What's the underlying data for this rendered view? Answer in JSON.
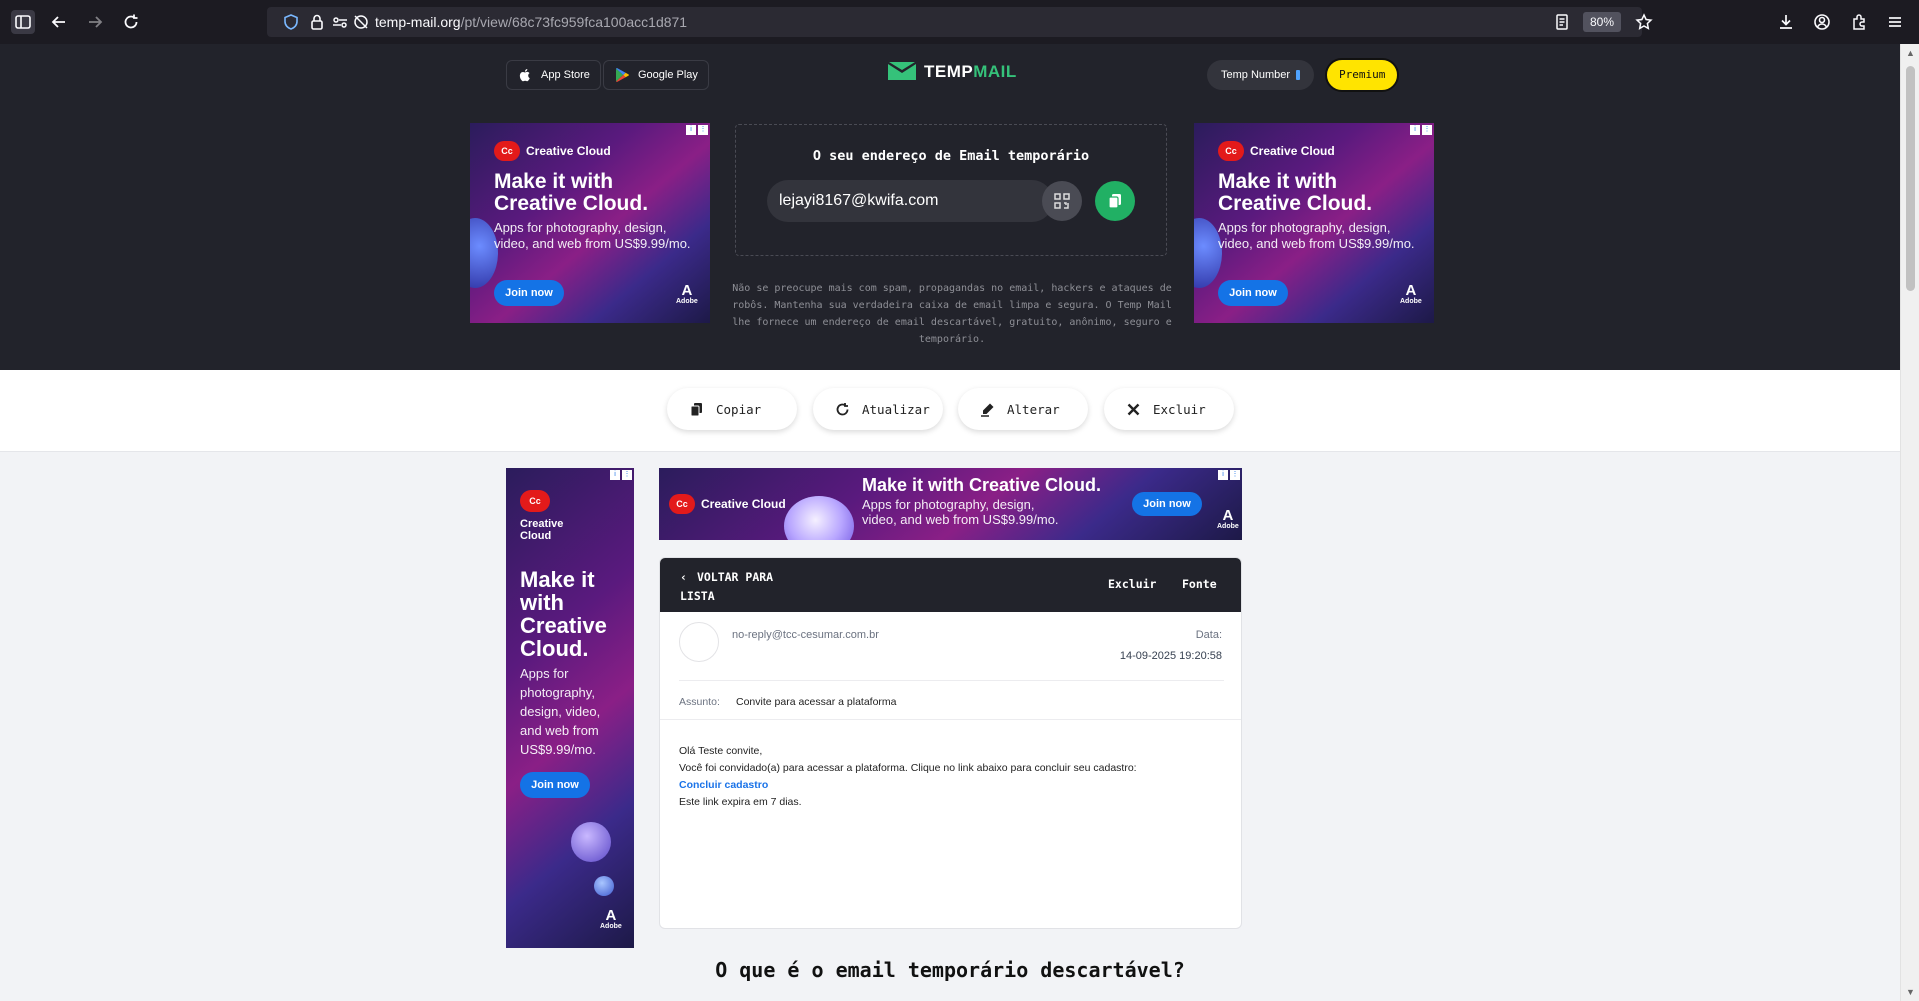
{
  "browser": {
    "url_host": "temp-mail.org",
    "url_path": "/pt/view/68c73fc959fca100acc1d871",
    "zoom": "80%"
  },
  "hero": {
    "app_store": "App Store",
    "google_play": "Google Play",
    "logo_temp": "TEMP",
    "logo_mail": "MAIL",
    "temp_number": "Temp Number",
    "premium": "Premium",
    "address_title": "O seu endereço de Email temporário",
    "email": "lejayi8167@kwifa.com",
    "description": "Não se preocupe mais com spam, propagandas no email, hackers e ataques de robôs. Mantenha sua verdadeira caixa de email limpa e segura. O Temp Mail lhe fornece um endereço de email descartável, gratuito, anônimo, seguro e temporário."
  },
  "ads": {
    "brand": "Creative Cloud",
    "brand_line1": "Creative",
    "brand_line2": "Cloud",
    "headline": "Make it with Creative Cloud.",
    "headline_tall_1": "Make it",
    "headline_tall_2": "with",
    "headline_tall_3": "Creative",
    "headline_tall_4": "Cloud.",
    "sub": "Apps for photography, design, video, and web from US$9.99/mo.",
    "join": "Join now",
    "adobe": "Adobe"
  },
  "actions": {
    "copy": "Copiar",
    "refresh": "Atualizar",
    "change": "Alterar",
    "delete": "Excluir"
  },
  "mail": {
    "back_line1": "VOLTAR PARA",
    "back_line2": "LISTA",
    "delete": "Excluir",
    "source": "Fonte",
    "from": "no-reply@tcc-cesumar.com.br",
    "date_label": "Data:",
    "date": "14-09-2025 19:20:58",
    "subject_label": "Assunto:",
    "subject": "Convite para acessar a plataforma",
    "body_greeting": "Olá Teste convite,",
    "body_line": "Você foi convidado(a) para acessar a plataforma. Clique no link abaixo para concluir seu cadastro:",
    "body_link": "Concluir cadastro",
    "body_expire": "Este link expira em 7 dias."
  },
  "faq_title": "O que é o email temporário descartável?",
  "colors": {
    "hero_bg": "#22232b",
    "accent_green": "#21b064",
    "premium_yellow": "#ffe400",
    "link_blue": "#1a73e8"
  }
}
